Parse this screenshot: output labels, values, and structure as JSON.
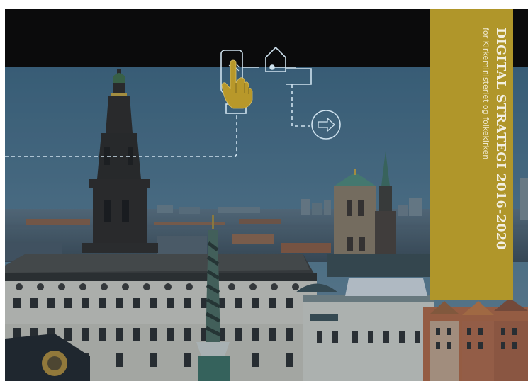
{
  "cover": {
    "title": "DIGITAL STRATEGI 2016-2020",
    "subtitle": "for Kirkeministeriet og folkekirken"
  },
  "colors": {
    "top_band": "#0b0b0c",
    "title_band": "#b0962a",
    "title_text": "#f3f0e3",
    "pictogram_line": "#cfe2ee",
    "hand": "#b8982a"
  },
  "icons": [
    "smartphone-icon",
    "pointing-hand-icon",
    "house-icon",
    "arrow-circle-icon"
  ]
}
